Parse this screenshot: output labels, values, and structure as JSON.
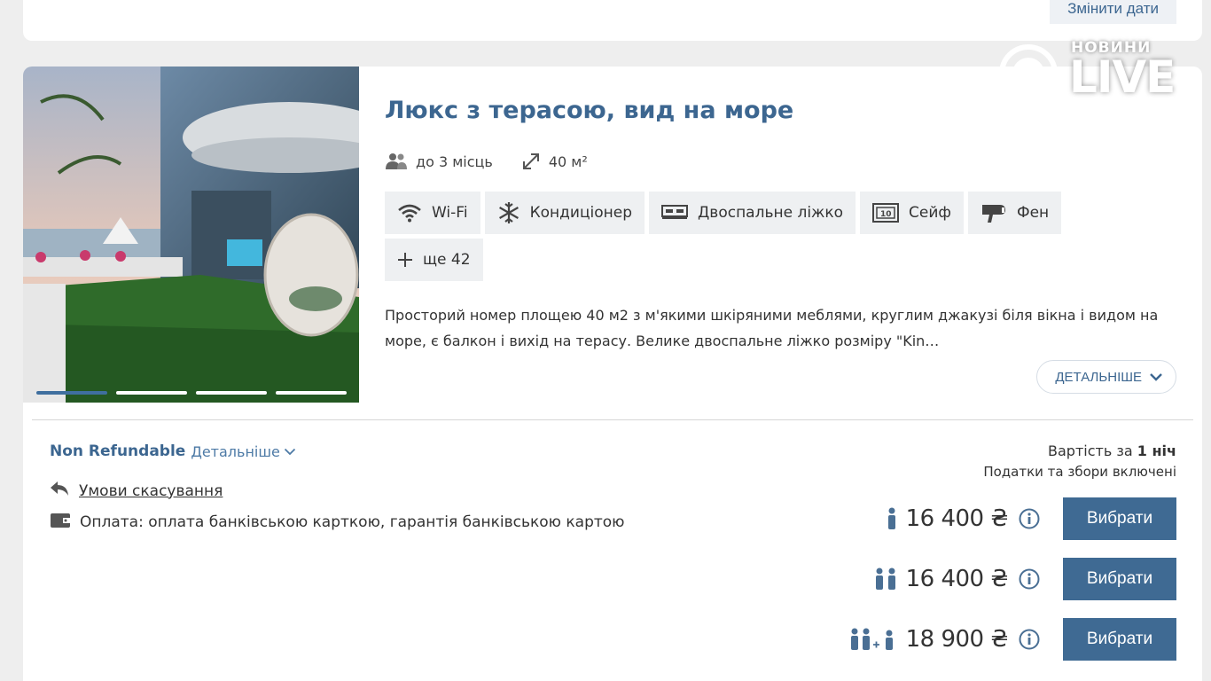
{
  "header": {
    "change_dates_label": "Змінити дати"
  },
  "room": {
    "title": "Люкс з терасою, вид на море",
    "capacity": "до 3 місць",
    "area": "40 м²",
    "amenities": [
      {
        "label": "Wi-Fi",
        "icon": "wifi-icon"
      },
      {
        "label": "Кондиціонер",
        "icon": "snowflake-icon"
      },
      {
        "label": "Двоспальне ліжко",
        "icon": "bed-icon"
      },
      {
        "label": "Сейф",
        "icon": "safe-icon"
      },
      {
        "label": "Фен",
        "icon": "hairdryer-icon"
      },
      {
        "label": "ще 42",
        "icon": "plus-icon"
      }
    ],
    "description": "Просторий номер площею 40 м2 з м'якими шкіряними меблями, круглим джакузі біля вікна і видом на море, є балкон і вихід на терасу. Велике двоспальне ліжко розміру \"Kin…",
    "details_label": "ДЕТАЛЬНІШЕ",
    "photo_count": 4,
    "active_photo": 1
  },
  "rate": {
    "name": "Non Refundable",
    "details_label": "Детальніше",
    "cancel_label": "Умови скасування",
    "payment_label": "Оплата: оплата банківською карткою, гарантія банківською картою",
    "price_header_prefix": "Вартість за",
    "price_header_nights": "1 ніч",
    "taxes_label": "Податки та збори включені",
    "prices": [
      {
        "guests": "1 adult",
        "amount": "16 400 ₴",
        "button": "Вибрати"
      },
      {
        "guests": "2 adults",
        "amount": "16 400 ₴",
        "button": "Вибрати"
      },
      {
        "guests": "2 adults + 1 child",
        "amount": "18 900 ₴",
        "button": "Вибрати"
      }
    ]
  },
  "watermark": {
    "small": "НОВИНИ",
    "big": "LIVE"
  },
  "colors": {
    "accent": "#3c6690",
    "button": "#3f6a93",
    "chip": "#eef0f2"
  }
}
